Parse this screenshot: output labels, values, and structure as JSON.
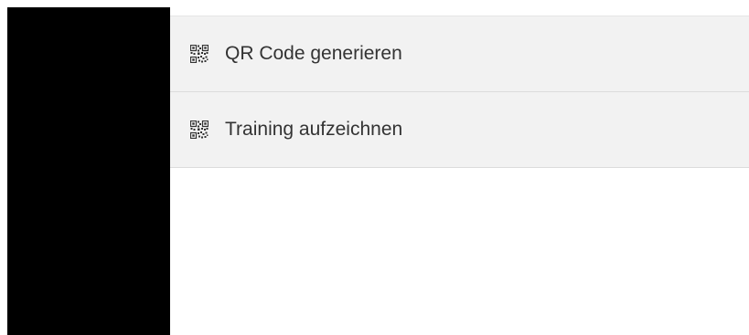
{
  "menu": {
    "items": [
      {
        "label": "QR Code generieren",
        "icon": "qr-code-icon"
      },
      {
        "label": "Training aufzeichnen",
        "icon": "qr-code-icon"
      }
    ]
  },
  "colors": {
    "item_background": "#f2f2f2",
    "text": "#333333",
    "left_panel": "#000000"
  }
}
